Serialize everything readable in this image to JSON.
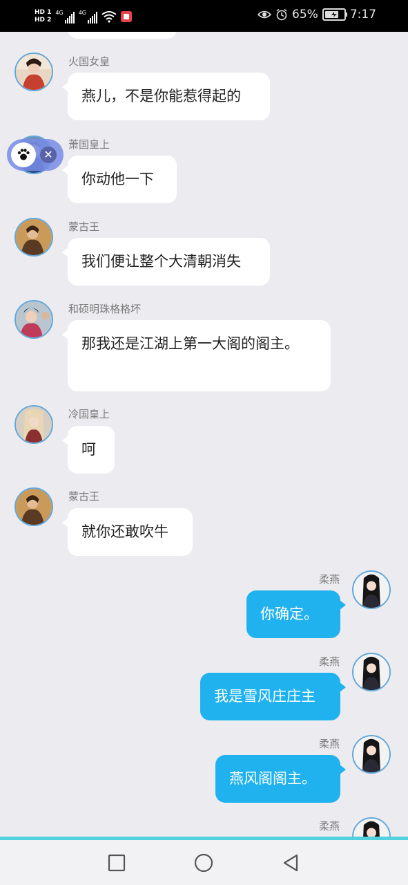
{
  "status_bar": {
    "hd1": "HD 1",
    "hd2": "HD 2",
    "net1": "4G",
    "net2": "4G",
    "battery": "65%",
    "time": "7:17"
  },
  "chat": {
    "messages": [
      {
        "sender": "火国女皇",
        "text": "燕儿，不是你能惹得起的",
        "side": "left"
      },
      {
        "sender": "萧国皇上",
        "text": "你动他一下",
        "side": "left"
      },
      {
        "sender": "蒙古王",
        "text": "我们便让整个大清朝消失",
        "side": "left"
      },
      {
        "sender": "和硕明珠格格坏",
        "text": "那我还是江湖上第一大阁的阁主。",
        "side": "left"
      },
      {
        "sender": "冷国皇上",
        "text": "呵",
        "side": "left"
      },
      {
        "sender": "蒙古王",
        "text": "就你还敢吹牛",
        "side": "left"
      },
      {
        "sender": "柔燕",
        "text": "你确定。",
        "side": "right"
      },
      {
        "sender": "柔燕",
        "text": "我是雪风庄庄主",
        "side": "right"
      },
      {
        "sender": "柔燕",
        "text": "燕风阁阁主。",
        "side": "right"
      },
      {
        "sender": "柔燕",
        "text": "",
        "side": "right"
      }
    ]
  },
  "floating_widget": {
    "icon": "paw-icon",
    "close_icon": "close-icon"
  },
  "nav": {
    "recents": "square-icon",
    "home": "circle-icon",
    "back": "triangle-icon"
  },
  "colors": {
    "bubble_right": "#1fb2ef",
    "background": "#ececf0",
    "accent_line": "#52d2de"
  }
}
